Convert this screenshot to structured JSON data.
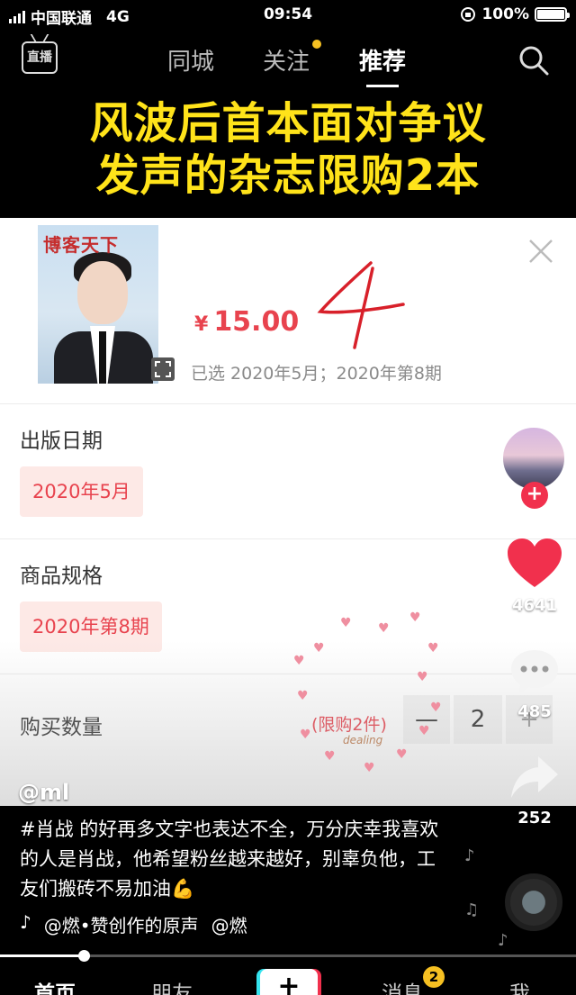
{
  "status_bar": {
    "carrier": "中国联通",
    "network": "4G",
    "time": "09:54",
    "battery": "100%"
  },
  "top_nav": {
    "live_label": "直播",
    "tabs": [
      "同城",
      "关注",
      "推荐"
    ]
  },
  "headline": {
    "line1": "风波后首本面对争议",
    "line2": "发声的杂志限购2本"
  },
  "product_sheet": {
    "magazine_title": "博客天下",
    "price_symbol": "¥",
    "price": "15.00",
    "annotation": "4",
    "selected_text": "已选 2020年5月；2020年第8期",
    "sections": [
      {
        "label": "出版日期",
        "option": "2020年5月"
      },
      {
        "label": "商品规格",
        "option": "2020年第8期"
      }
    ],
    "quantity": {
      "label": "购买数量",
      "limit": "(限购2件)",
      "minus": "—",
      "value": "2",
      "plus": "+"
    }
  },
  "overlay": {
    "signature": "dealing",
    "author": "@ml"
  },
  "right_rail": {
    "likes": "4641",
    "comments": "485",
    "shares": "252"
  },
  "caption": "#肖战 的好再多文字也表达不全，万分庆幸我喜欢的人是肖战，他希望粉丝越来越好，别辜负他，工友们搬砖不易加油💪",
  "music": {
    "icon": "♪",
    "text": "@燃•赞创作的原声",
    "text2": "@燃"
  },
  "progress": {
    "percent": 14.5
  },
  "bottom_nav": {
    "home": "首页",
    "friends": "朋友",
    "add": "+",
    "messages": "消息",
    "messages_badge": "2",
    "me": "我"
  },
  "colors": {
    "headline": "#ffe31a",
    "price": "#e8434e",
    "accent": "#f1304d",
    "dot": "#f6c022"
  }
}
